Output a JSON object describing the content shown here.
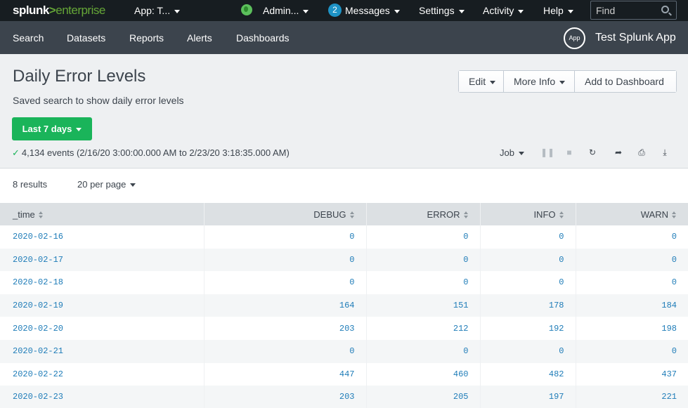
{
  "topbar": {
    "logo_left": "splunk",
    "logo_gt": ">",
    "logo_right": "enterprise",
    "app_menu": "App: T...",
    "admin_menu": "Admin...",
    "messages_count": "2",
    "messages_label": "Messages",
    "settings_label": "Settings",
    "activity_label": "Activity",
    "help_label": "Help",
    "find_placeholder": "Find"
  },
  "navbar": {
    "items": [
      "Search",
      "Datasets",
      "Reports",
      "Alerts",
      "Dashboards"
    ],
    "app_icon_label": "App",
    "app_name": "Test Splunk App"
  },
  "header": {
    "title": "Daily Error Levels",
    "description": "Saved search to show daily error levels",
    "buttons": {
      "edit": "Edit",
      "more_info": "More Info",
      "add_to_dashboard": "Add to Dashboard"
    },
    "time_range": "Last 7 days",
    "events_summary": "4,134 events (2/16/20 3:00:00.000 AM to 2/23/20 3:18:35.000 AM)",
    "job_label": "Job"
  },
  "results": {
    "count": "8 results",
    "per_page": "20 per page"
  },
  "table": {
    "columns": [
      "_time",
      "DEBUG",
      "ERROR",
      "INFO",
      "WARN"
    ],
    "rows": [
      [
        "2020-02-16",
        "0",
        "0",
        "0",
        "0"
      ],
      [
        "2020-02-17",
        "0",
        "0",
        "0",
        "0"
      ],
      [
        "2020-02-18",
        "0",
        "0",
        "0",
        "0"
      ],
      [
        "2020-02-19",
        "164",
        "151",
        "178",
        "184"
      ],
      [
        "2020-02-20",
        "203",
        "212",
        "192",
        "198"
      ],
      [
        "2020-02-21",
        "0",
        "0",
        "0",
        "0"
      ],
      [
        "2020-02-22",
        "447",
        "460",
        "482",
        "437"
      ],
      [
        "2020-02-23",
        "203",
        "205",
        "197",
        "221"
      ]
    ]
  },
  "colors": {
    "topbar_bg": "#171d21",
    "navbar_bg": "#3c444d",
    "accent_green": "#1ab45a",
    "link_blue": "#1e7cb8"
  }
}
